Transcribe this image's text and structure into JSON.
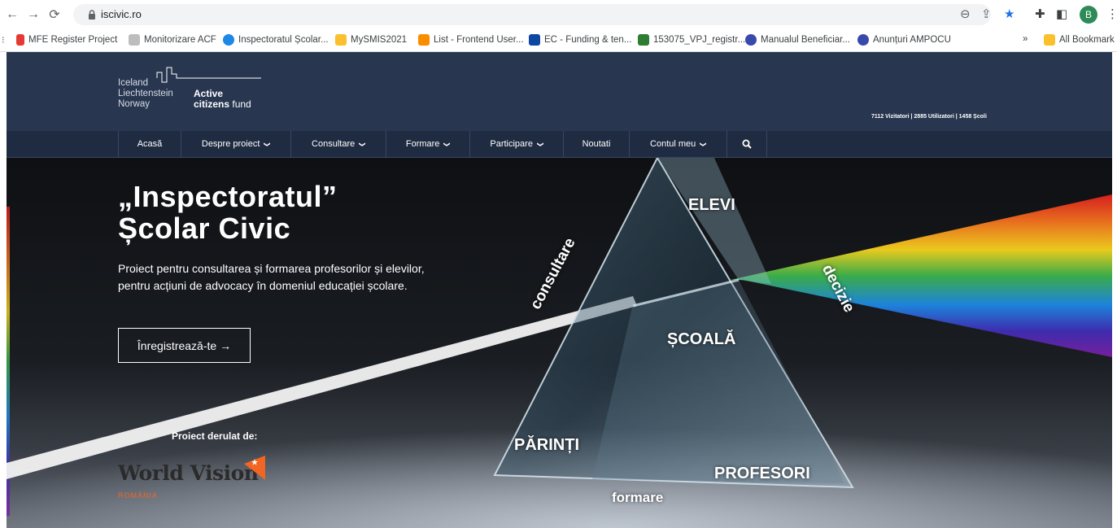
{
  "browser": {
    "url": "iscivic.ro",
    "avatar_letter": "B",
    "bookmarks": [
      {
        "label": "MFE Register Project",
        "color": "#e53935"
      },
      {
        "label": "Monitorizare ACF",
        "color": "#9e9e9e"
      },
      {
        "label": "Inspectoratul Școlar...",
        "color": "#1e88e5"
      },
      {
        "label": "MySMIS2021",
        "color": "#fbc02d"
      },
      {
        "label": "List - Frontend User...",
        "color": "#fb8c00"
      },
      {
        "label": "EC - Funding & ten...",
        "color": "#0d47a1"
      },
      {
        "label": "153075_VPJ_registr...",
        "color": "#2e7d32"
      },
      {
        "label": "Manualul Beneficiar...",
        "color": "#3949ab"
      },
      {
        "label": "Anunțuri AMPOCU",
        "color": "#3949ab"
      }
    ],
    "overflow": "»",
    "all_bookmarks": "All Bookmark"
  },
  "header": {
    "logo_countries": [
      "Iceland",
      "Liechtenstein",
      "Norway"
    ],
    "logo_active": "Active",
    "logo_citizens": "citizens",
    "logo_fund": "fund",
    "stats": "7112 Vizitatori | 2885 Utilizatori | 1458 Școli"
  },
  "nav": {
    "items": [
      {
        "label": "Acasă",
        "dropdown": false
      },
      {
        "label": "Despre proiect",
        "dropdown": true
      },
      {
        "label": "Consultare",
        "dropdown": true
      },
      {
        "label": "Formare",
        "dropdown": true
      },
      {
        "label": "Participare",
        "dropdown": true
      },
      {
        "label": "Noutati",
        "dropdown": false
      },
      {
        "label": "Contul meu",
        "dropdown": true
      }
    ],
    "chevron": "❯"
  },
  "hero": {
    "title_line1": "„Inspectoratul”",
    "title_line2": "Școlar Civic",
    "description": "Proiect pentru consultarea și formarea profesorilor și elevilor, pentru acțiuni de advocacy în domeniul educației școlare.",
    "cta_label": "Înregistrează-te →",
    "derulat": "Proiect derulat de:",
    "partner_name": "World Vision",
    "partner_country": "ROMÂNIA",
    "prism_labels": {
      "elevi": "ELEVI",
      "consultare": "consultare",
      "decizie": "decizie",
      "scoala": "ȘCOALĂ",
      "parinti": "PĂRINȚI",
      "profesori": "PROFESORI",
      "formare": "formare"
    }
  }
}
